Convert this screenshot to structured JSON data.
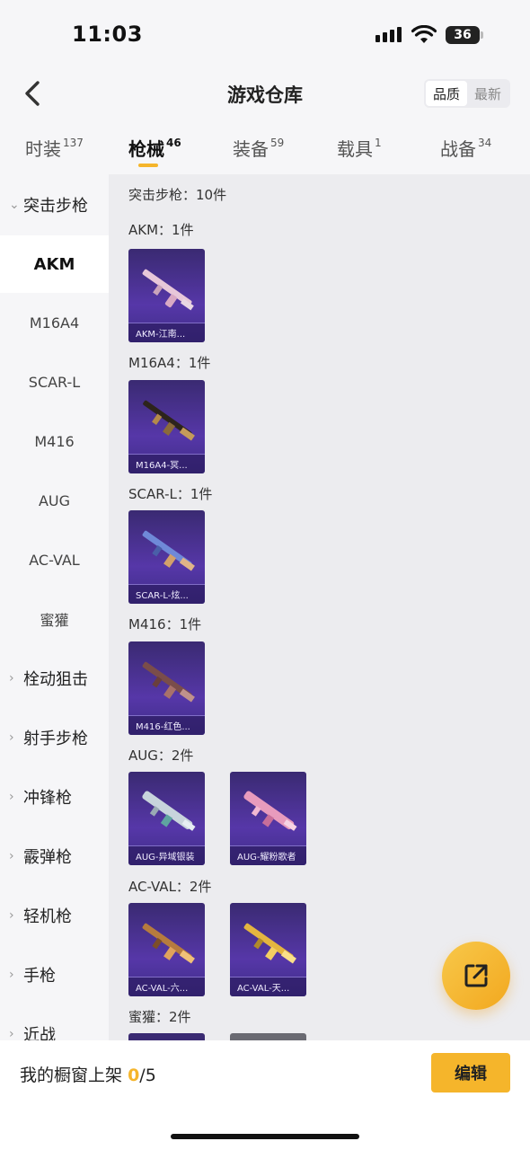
{
  "status_bar": {
    "time": "11:03",
    "battery": "36"
  },
  "header": {
    "title": "游戏仓库",
    "sort_options": [
      "品质",
      "最新"
    ]
  },
  "tabs": [
    {
      "label": "时装",
      "count": "137"
    },
    {
      "label": "枪械",
      "count": "46"
    },
    {
      "label": "装备",
      "count": "59"
    },
    {
      "label": "载具",
      "count": "1"
    },
    {
      "label": "战备",
      "count": "34"
    }
  ],
  "sidebar": {
    "expanded_group": "突击步枪",
    "subitems": [
      "AKM",
      "M16A4",
      "SCAR-L",
      "M416",
      "AUG",
      "AC-VAL",
      "蜜獾"
    ],
    "groups": [
      "栓动狙击",
      "射手步枪",
      "冲锋枪",
      "霰弹枪",
      "轻机枪",
      "手枪",
      "近战"
    ]
  },
  "content": {
    "category_title": "突击步枪：10件",
    "sections": [
      {
        "title": "AKM：1件",
        "items": [
          "AKM-江南..."
        ]
      },
      {
        "title": "M16A4：1件",
        "items": [
          "M16A4-冥..."
        ]
      },
      {
        "title": "SCAR-L：1件",
        "items": [
          "SCAR-L-炫..."
        ]
      },
      {
        "title": "M416：1件",
        "items": [
          "M416-红色..."
        ]
      },
      {
        "title": "AUG：2件",
        "items": [
          "AUG-异域银装",
          "AUG-耀粉歌者"
        ]
      },
      {
        "title": "AC-VAL：2件",
        "items": [
          "AC-VAL-六...",
          "AC-VAL-天..."
        ]
      },
      {
        "title": "蜜獾：2件",
        "items": []
      }
    ]
  },
  "bottom_bar": {
    "shelf_label": "我的橱窗上架",
    "shelf_count": "0",
    "shelf_total": "/5",
    "edit_label": "编辑"
  },
  "colors": {
    "accent": "#f5b52b",
    "card_bg": "#4a3296"
  }
}
